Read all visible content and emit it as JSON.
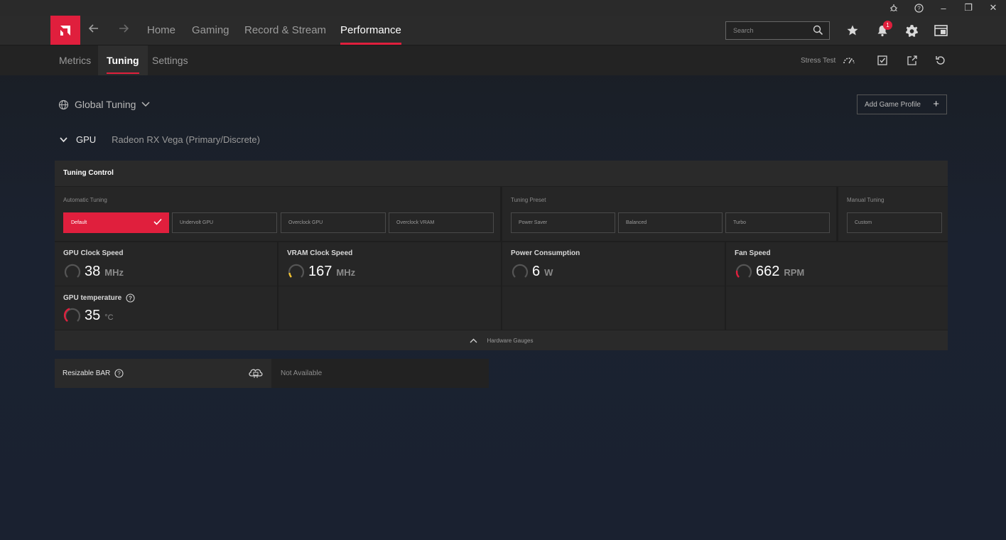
{
  "window_controls": {
    "bug_icon": "bug-icon",
    "help_icon": "help-icon",
    "minimize": "–",
    "restore": "❐",
    "close": "✕"
  },
  "nav": {
    "links": [
      "Home",
      "Gaming",
      "Record & Stream",
      "Performance"
    ],
    "active": "Performance",
    "search_placeholder": "Search",
    "notification_count": "1"
  },
  "subnav": {
    "tabs": [
      "Metrics",
      "Tuning",
      "Settings"
    ],
    "active": "Tuning",
    "stress_test_label": "Stress Test"
  },
  "content": {
    "global_tuning": "Global Tuning",
    "add_game_profile": "Add Game Profile",
    "gpu_title": "GPU",
    "gpu_name": "Radeon RX Vega (Primary/Discrete)"
  },
  "tuning_control": {
    "title": "Tuning Control",
    "automatic": {
      "label": "Automatic Tuning",
      "options": [
        "Default",
        "Undervolt GPU",
        "Overclock GPU",
        "Overclock VRAM"
      ],
      "selected": "Default"
    },
    "preset": {
      "label": "Tuning Preset",
      "options": [
        "Power Saver",
        "Balanced",
        "Turbo"
      ]
    },
    "manual": {
      "label": "Manual Tuning",
      "options": [
        "Custom"
      ]
    }
  },
  "metrics": [
    {
      "label": "GPU Clock Speed",
      "value": "38",
      "unit": "MHz",
      "gauge_color": "#555555"
    },
    {
      "label": "VRAM Clock Speed",
      "value": "167",
      "unit": "MHz",
      "gauge_color": "#f2c230"
    },
    {
      "label": "Power Consumption",
      "value": "6",
      "unit": "W",
      "gauge_color": "#555555"
    },
    {
      "label": "Fan Speed",
      "value": "662",
      "unit": "RPM",
      "gauge_color": "#e01f3d"
    },
    {
      "label": "GPU temperature",
      "value": "35",
      "unit": "°C",
      "gauge_color": "#e01f3d"
    }
  ],
  "hardware_gauges_label": "Hardware Gauges",
  "resizable_bar": {
    "label": "Resizable BAR",
    "value": "Not Available"
  },
  "colors": {
    "accent": "#e01f3d"
  }
}
